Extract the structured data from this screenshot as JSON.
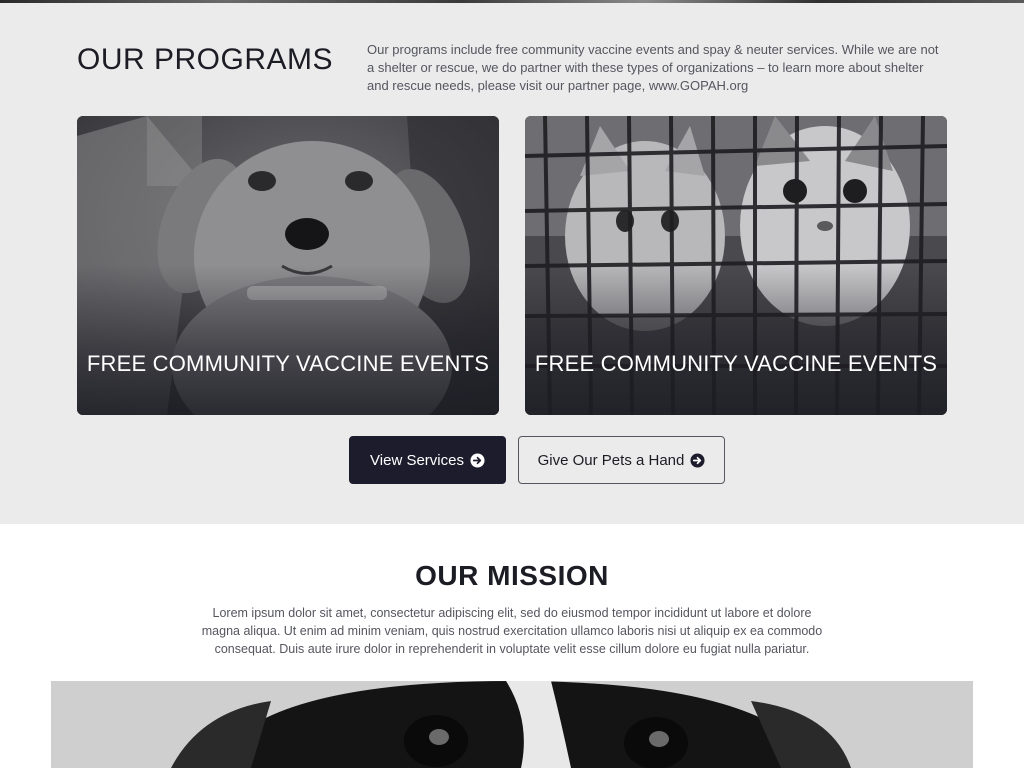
{
  "programs": {
    "title": "OUR PROGRAMS",
    "description": "Our programs include free community vaccine events and spay & neuter services. While we are not a shelter or rescue, we do partner with these types of organizations – to learn more about shelter and rescue needs, please visit our partner page, www.GOPAH.org",
    "cards": [
      {
        "label": "FREE COMMUNITY VACCINE EVENTS",
        "image": "puppy-photo"
      },
      {
        "label": "FREE COMMUNITY VACCINE EVENTS",
        "image": "kittens-in-cage-photo"
      }
    ],
    "buttons": {
      "primary_label": "View Services",
      "secondary_label": "Give Our Pets a Hand",
      "icon": "arrow-right-circle-icon"
    }
  },
  "mission": {
    "title": "OUR MISSION",
    "text": "Lorem ipsum dolor sit amet, consectetur adipiscing elit, sed do eiusmod tempor incididunt ut labore et dolore magna aliqua. Ut enim ad minim veniam, quis nostrud exercitation ullamco laboris nisi ut aliquip ex ea commodo consequat. Duis aute irure dolor in reprehenderit in voluptate velit esse cillum dolore eu fugiat nulla pariatur.",
    "image": "dog-closeup-photo"
  },
  "colors": {
    "section_bg": "#ebebeb",
    "dark_navy": "#1c1c2c",
    "body_text": "#55565e",
    "white": "#ffffff"
  }
}
